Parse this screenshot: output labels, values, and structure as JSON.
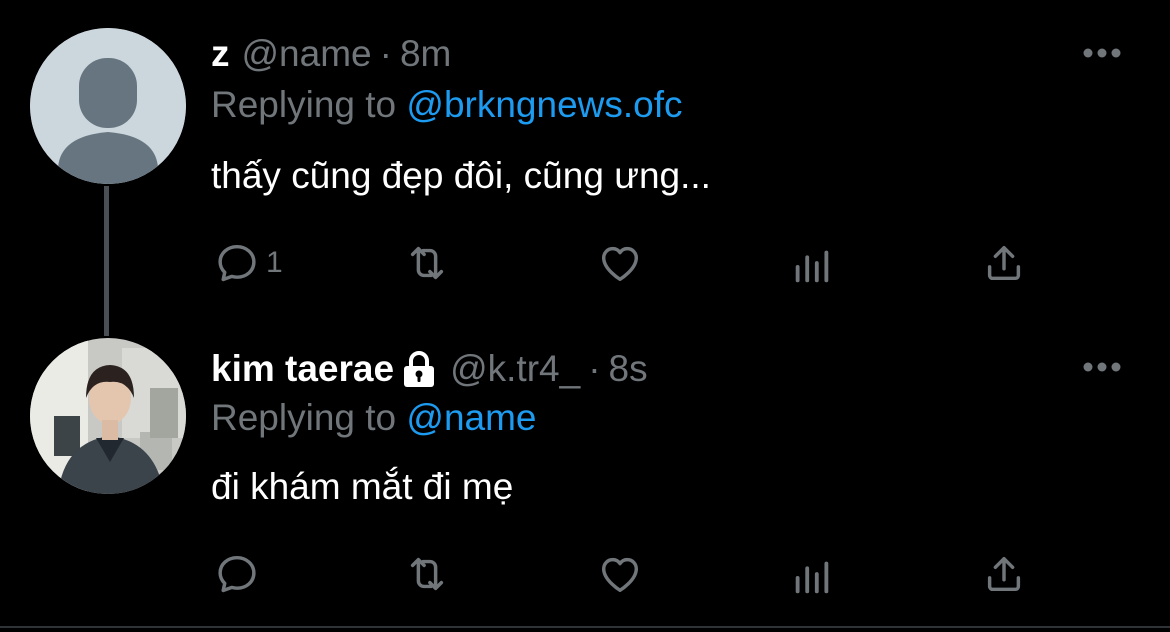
{
  "tweets": [
    {
      "display_name": "z",
      "handle": "@name",
      "separator": "·",
      "time": "8m",
      "replying_prefix": "Replying to",
      "replying_to": "@brkngnews.ofc",
      "text": "thấy cũng đẹp đôi, cũng ưng...",
      "reply_count": "1",
      "avatar": "default-profile-avatar",
      "locked": false
    },
    {
      "display_name": "kim taerae",
      "handle": "@k.tr4_",
      "separator": "·",
      "time": "8s",
      "replying_prefix": "Replying to",
      "replying_to": "@name",
      "text": "đi khám mắt đi mẹ",
      "reply_count": "",
      "avatar": "photo-avatar",
      "locked": true
    }
  ],
  "icons": {
    "reply": "reply-icon",
    "retweet": "retweet-icon",
    "like": "heart-icon",
    "analytics": "analytics-icon",
    "share": "share-icon",
    "more": "more-icon",
    "lock": "lock-icon"
  },
  "colors": {
    "background": "#000000",
    "text": "#ffffff",
    "muted": "#71767b",
    "accent": "#1d9bf0",
    "thread_line": "#4a4f55"
  }
}
